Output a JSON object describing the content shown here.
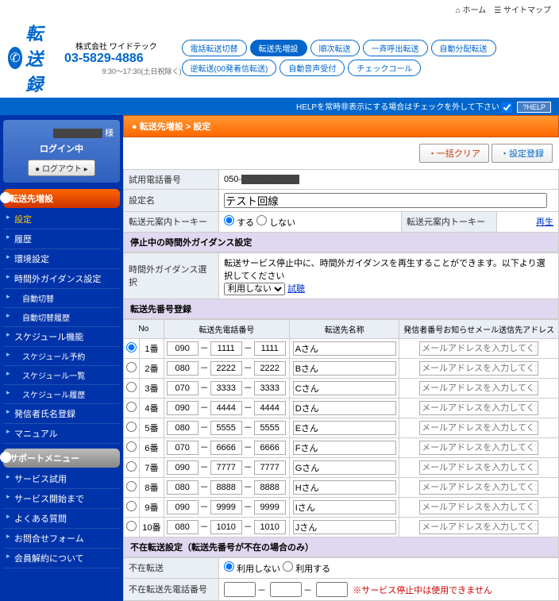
{
  "topbar": {
    "home": "ホーム",
    "sitemap": "サイトマップ"
  },
  "logo": {
    "text": "転送録"
  },
  "company": {
    "name": "株式会社 ワイドテック",
    "phone": "03-5829-4886",
    "hours": "9:30～17:30(土日祝除く)"
  },
  "tabs": [
    "電話転送切替",
    "転送先増設",
    "順次転送",
    "一斉呼出転送",
    "自動分配転送",
    "逆転送(00発着信転送)",
    "自動音声受付",
    "チェックコール"
  ],
  "helpbar": {
    "text": "HELPを常時非表示にする場合はチェックを外して下さい",
    "btn": "?HELP"
  },
  "login": {
    "user": "様",
    "status": "ログイン中",
    "logout": "ログアウト"
  },
  "navhead1": "転送先増設",
  "nav1": [
    "設定",
    "履歴",
    "環境設定",
    "時間外ガイダンス設定",
    "自動切替",
    "自動切替履歴",
    "スケジュール機能",
    "スケジュール予約",
    "スケジュール一覧",
    "スケジュール履歴",
    "発信者氏名登録",
    "マニュアル"
  ],
  "navhead2": "サポートメニュー",
  "nav2": [
    "サービス試用",
    "サービス開始まで",
    "よくある質問",
    "お問合せフォーム",
    "会員解約について"
  ],
  "breadcrumb": "● 転送先増設 > 設定",
  "actions": {
    "clear": "・一括クリア",
    "save": "・設定登録"
  },
  "form": {
    "trialLabel": "試用電話番号",
    "trialPrefix": "050-",
    "nameLabel": "設定名",
    "nameValue": "テスト回線",
    "talkyLabel": "転送元案内トーキー",
    "opt1": "する",
    "opt2": "しない",
    "talkyLabel2": "転送元案内トーキー",
    "play": "再生"
  },
  "section1": "停止中の時間外ガイダンス設定",
  "guidance": {
    "label": "時間外ガイダンス選択",
    "text": "転送サービス停止中に、時間外ガイダンスを再生することができます。以下より選択してください",
    "select": "利用しない",
    "listen": "試聴"
  },
  "section2": "転送先番号登録",
  "headers": {
    "no": "No",
    "phone": "転送先電話番号",
    "name": "転送先名称",
    "mail": "発信者番号お知らせメール送信先アドレス"
  },
  "rows": [
    {
      "no": "1番",
      "p1": "090",
      "p2": "1111",
      "p3": "1111",
      "name": "Aさん"
    },
    {
      "no": "2番",
      "p1": "080",
      "p2": "2222",
      "p3": "2222",
      "name": "Bさん"
    },
    {
      "no": "3番",
      "p1": "070",
      "p2": "3333",
      "p3": "3333",
      "name": "Cさん"
    },
    {
      "no": "4番",
      "p1": "090",
      "p2": "4444",
      "p3": "4444",
      "name": "Dさん"
    },
    {
      "no": "5番",
      "p1": "080",
      "p2": "5555",
      "p3": "5555",
      "name": "Eさん"
    },
    {
      "no": "6番",
      "p1": "070",
      "p2": "6666",
      "p3": "6666",
      "name": "Fさん"
    },
    {
      "no": "7番",
      "p1": "090",
      "p2": "7777",
      "p3": "7777",
      "name": "Gさん"
    },
    {
      "no": "8番",
      "p1": "080",
      "p2": "8888",
      "p3": "8888",
      "name": "Hさん"
    },
    {
      "no": "9番",
      "p1": "090",
      "p2": "9999",
      "p3": "9999",
      "name": "Iさん"
    },
    {
      "no": "10番",
      "p1": "080",
      "p2": "1010",
      "p3": "1010",
      "name": "Jさん"
    }
  ],
  "mailPlaceholder": "メールアドレスを入力してください",
  "section3": "不在転送設定（転送先番号が不在の場合のみ）",
  "absent": {
    "label1": "不在転送",
    "opt1": "利用しない",
    "opt2": "利用する",
    "label2": "不在転送先電話番号",
    "note": "※サービス停止中は使用できません"
  }
}
